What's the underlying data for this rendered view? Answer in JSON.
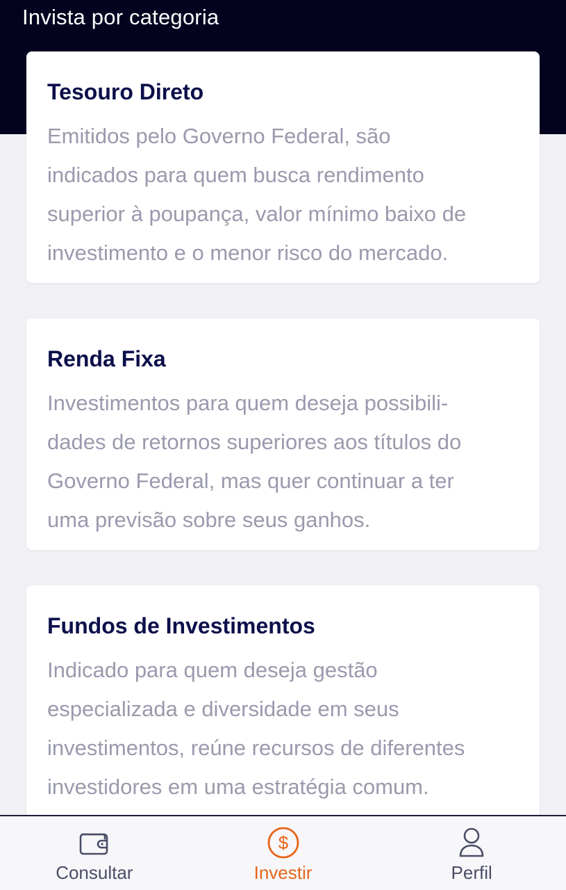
{
  "header": {
    "title": "Invista por categoria",
    "background": "#03031f"
  },
  "categories": [
    {
      "title": "Tesouro Direto",
      "description": "Emitidos pelo Governo Federal, são\nindicados para quem busca rendimento\nsuperior à poupança, valor mínimo baixo de\ninvestimento e o menor risco do mercado."
    },
    {
      "title": "Renda Fixa",
      "description": "Investimentos para quem deseja possibili-\ndades de retornos superiores aos títulos do\nGoverno Federal, mas quer continuar a ter\numa previsão sobre seus ganhos."
    },
    {
      "title": "Fundos de Investimentos",
      "description": "Indicado para quem deseja gestão\nespecializada e diversidade em seus\ninvestimentos, reúne recursos de diferentes\ninvestidores em uma estratégia comum."
    }
  ],
  "bottom_nav": {
    "items": [
      {
        "label": "Consultar",
        "icon": "wallet-icon",
        "active": false
      },
      {
        "label": "Investir",
        "icon": "dollar-circle-icon",
        "active": true
      },
      {
        "label": "Perfil",
        "icon": "user-icon",
        "active": false
      }
    ],
    "active_color": "#e8651a",
    "inactive_color": "#4a4d66"
  }
}
